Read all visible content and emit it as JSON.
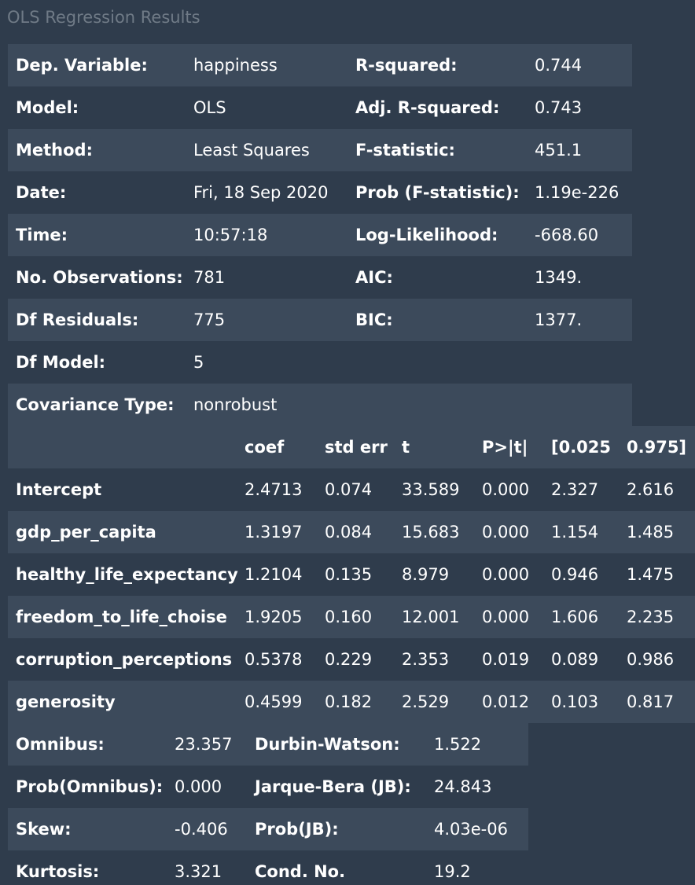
{
  "caption": "OLS Regression Results",
  "summary": {
    "rows": [
      [
        "Dep. Variable:",
        "happiness",
        "R-squared:",
        "0.744"
      ],
      [
        "Model:",
        "OLS",
        "Adj. R-squared:",
        "0.743"
      ],
      [
        "Method:",
        "Least Squares",
        "F-statistic:",
        "451.1"
      ],
      [
        "Date:",
        "Fri, 18 Sep 2020",
        "Prob (F-statistic):",
        "1.19e-226"
      ],
      [
        "Time:",
        "10:57:18",
        "Log-Likelihood:",
        "-668.60"
      ],
      [
        "No. Observations:",
        "781",
        "AIC:",
        "1349."
      ],
      [
        "Df Residuals:",
        "775",
        "BIC:",
        "1377."
      ],
      [
        "Df Model:",
        "5",
        "",
        ""
      ],
      [
        "Covariance Type:",
        "nonrobust",
        "",
        ""
      ]
    ]
  },
  "coefficients": {
    "headers": [
      "",
      "coef",
      "std err",
      "t",
      "P>|t|",
      "[0.025",
      "0.975]"
    ],
    "rows": [
      [
        "Intercept",
        "2.4713",
        "0.074",
        "33.589",
        "0.000",
        "2.327",
        "2.616"
      ],
      [
        "gdp_per_capita",
        "1.3197",
        "0.084",
        "15.683",
        "0.000",
        "1.154",
        "1.485"
      ],
      [
        "healthy_life_expectancy",
        "1.2104",
        "0.135",
        "8.979",
        "0.000",
        "0.946",
        "1.475"
      ],
      [
        "freedom_to_life_choise",
        "1.9205",
        "0.160",
        "12.001",
        "0.000",
        "1.606",
        "2.235"
      ],
      [
        "corruption_perceptions",
        "0.5378",
        "0.229",
        "2.353",
        "0.019",
        "0.089",
        "0.986"
      ],
      [
        "generosity",
        "0.4599",
        "0.182",
        "2.529",
        "0.012",
        "0.103",
        "0.817"
      ]
    ]
  },
  "diagnostics": {
    "rows": [
      [
        "Omnibus:",
        "23.357",
        "Durbin-Watson:",
        "1.522"
      ],
      [
        "Prob(Omnibus):",
        "0.000",
        "Jarque-Bera (JB):",
        "24.843"
      ],
      [
        "Skew:",
        "-0.406",
        "Prob(JB):",
        "4.03e-06"
      ],
      [
        "Kurtosis:",
        "3.321",
        "Cond. No.",
        "19.2"
      ]
    ]
  }
}
